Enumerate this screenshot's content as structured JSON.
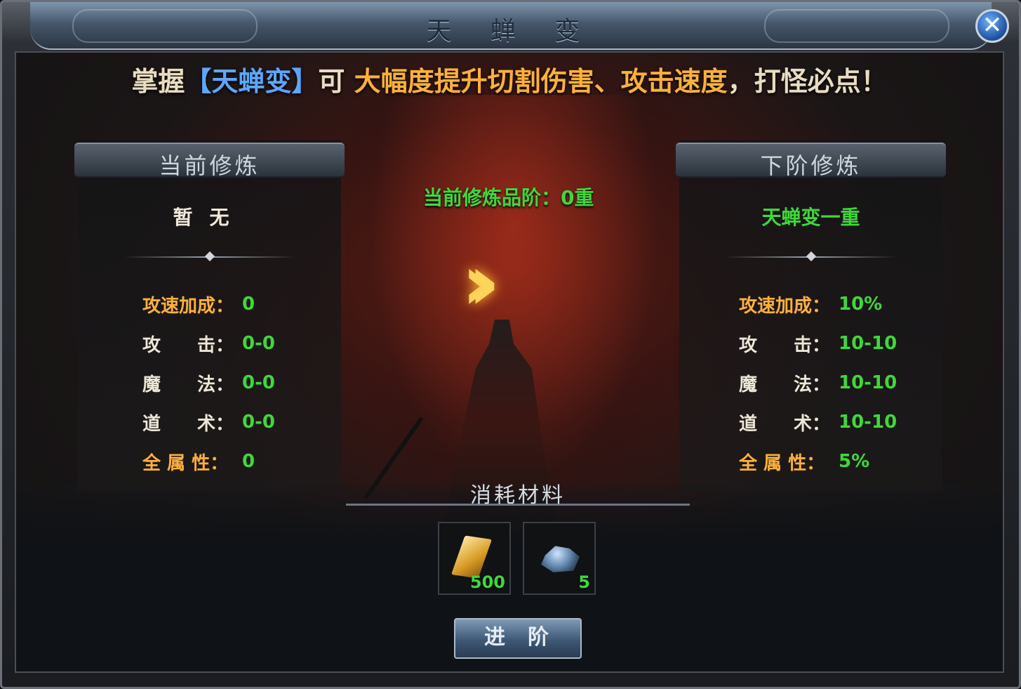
{
  "window": {
    "title": "天 蝉 变",
    "close_label": "✕"
  },
  "banner": {
    "prefix": "掌握",
    "skill": "【天蝉变】",
    "middle": "可",
    "effect": "大幅度提升切割伤害、攻击速度",
    "suffix": "，打怪必点！"
  },
  "current_grade": "当前修炼品阶：0重",
  "left_panel": {
    "header": "当前修炼",
    "subtitle": "暂无",
    "stats": [
      {
        "label": "攻速加成：",
        "value": "0"
      },
      {
        "label": "攻　　击：",
        "value": "0-0"
      },
      {
        "label": "魔　　法：",
        "value": "0-0"
      },
      {
        "label": "道　　术：",
        "value": "0-0"
      },
      {
        "label": "全 属 性：",
        "value": "0"
      }
    ]
  },
  "right_panel": {
    "header": "下阶修炼",
    "subtitle": "天蝉变一重",
    "stats": [
      {
        "label": "攻速加成：",
        "value": "10%"
      },
      {
        "label": "攻　　击：",
        "value": "10-10"
      },
      {
        "label": "魔　　法：",
        "value": "10-10"
      },
      {
        "label": "道　　术：",
        "value": "10-10"
      },
      {
        "label": "全 属 性：",
        "value": "5%"
      }
    ]
  },
  "materials": {
    "header": "消耗材料",
    "items": [
      {
        "icon": "gold-ticket-icon",
        "count": "500"
      },
      {
        "icon": "ore-icon",
        "count": "5"
      }
    ]
  },
  "advance_button": "进阶",
  "colors": {
    "green": "#3fd83a",
    "gold": "#ffb13a",
    "blue": "#5da6ff"
  }
}
